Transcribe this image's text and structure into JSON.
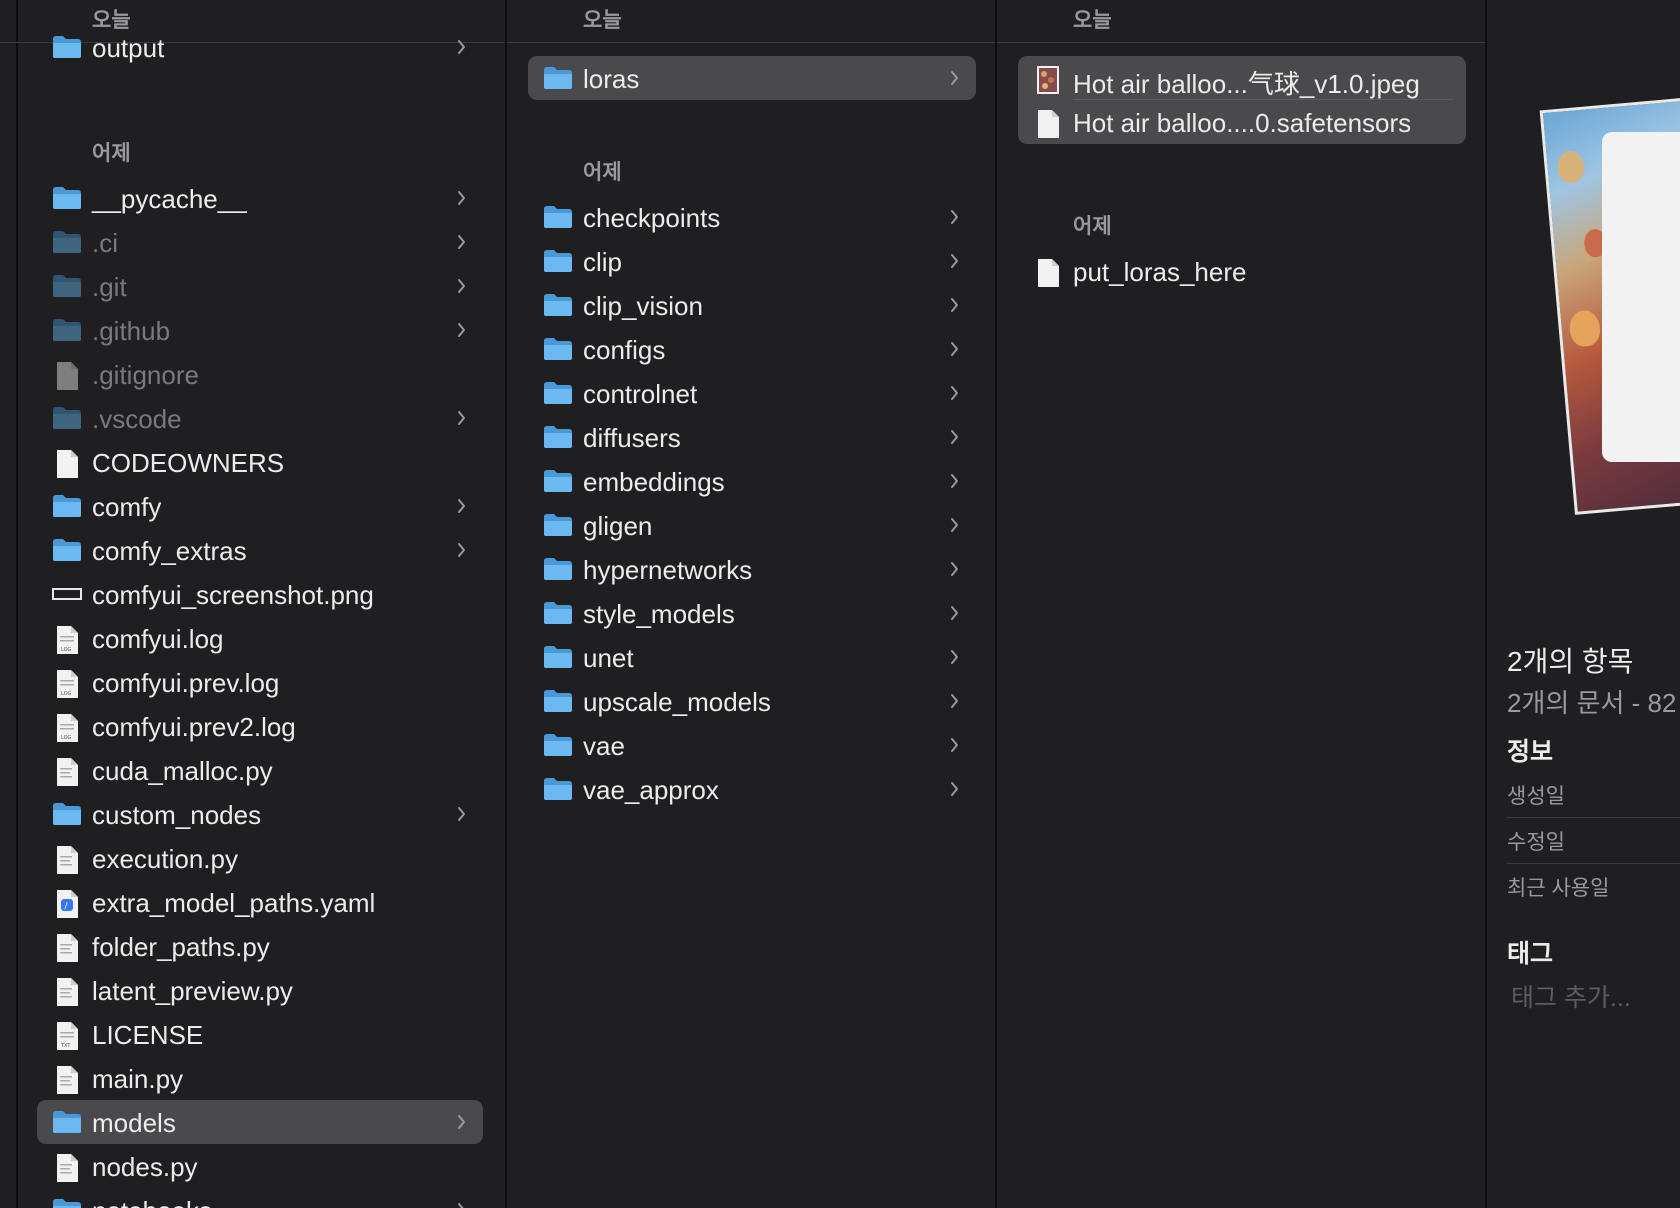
{
  "colors": {
    "background": "#1f1f21",
    "selection": "#4a4a4c",
    "folder": "#5aa9e6",
    "text": "#ececec",
    "secondary_text": "#9a9a9e"
  },
  "col1": {
    "header": "오늘",
    "top_item": {
      "label": "output",
      "icon": "folder-icon",
      "chevron": true
    },
    "section_yesterday": "어제",
    "items": [
      {
        "label": "__pycache__",
        "icon": "folder-icon",
        "chevron": true,
        "dim": false
      },
      {
        "label": ".ci",
        "icon": "folder-icon",
        "chevron": true,
        "dim": true
      },
      {
        "label": ".git",
        "icon": "folder-icon",
        "chevron": true,
        "dim": true
      },
      {
        "label": ".github",
        "icon": "folder-icon",
        "chevron": true,
        "dim": true
      },
      {
        "label": ".gitignore",
        "icon": "document-icon",
        "chevron": false,
        "dim": true
      },
      {
        "label": ".vscode",
        "icon": "folder-icon",
        "chevron": true,
        "dim": true
      },
      {
        "label": "CODEOWNERS",
        "icon": "document-icon",
        "chevron": false,
        "dim": false
      },
      {
        "label": "comfy",
        "icon": "folder-icon",
        "chevron": true,
        "dim": false
      },
      {
        "label": "comfy_extras",
        "icon": "folder-icon",
        "chevron": true,
        "dim": false
      },
      {
        "label": "comfyui_screenshot.png",
        "icon": "image-file-icon",
        "chevron": false,
        "dim": false
      },
      {
        "label": "comfyui.log",
        "icon": "log-file-icon",
        "chevron": false,
        "dim": false
      },
      {
        "label": "comfyui.prev.log",
        "icon": "log-file-icon",
        "chevron": false,
        "dim": false
      },
      {
        "label": "comfyui.prev2.log",
        "icon": "log-file-icon",
        "chevron": false,
        "dim": false
      },
      {
        "label": "cuda_malloc.py",
        "icon": "python-file-icon",
        "chevron": false,
        "dim": false
      },
      {
        "label": "custom_nodes",
        "icon": "folder-icon",
        "chevron": true,
        "dim": false
      },
      {
        "label": "execution.py",
        "icon": "python-file-icon",
        "chevron": false,
        "dim": false
      },
      {
        "label": "extra_model_paths.yaml",
        "icon": "yaml-file-icon",
        "chevron": false,
        "dim": false
      },
      {
        "label": "folder_paths.py",
        "icon": "python-file-icon",
        "chevron": false,
        "dim": false
      },
      {
        "label": "latent_preview.py",
        "icon": "python-file-icon",
        "chevron": false,
        "dim": false
      },
      {
        "label": "LICENSE",
        "icon": "text-file-icon",
        "chevron": false,
        "dim": false
      },
      {
        "label": "main.py",
        "icon": "python-file-icon",
        "chevron": false,
        "dim": false
      },
      {
        "label": "models",
        "icon": "folder-icon",
        "chevron": true,
        "dim": false,
        "selected": true
      },
      {
        "label": "nodes.py",
        "icon": "python-file-icon",
        "chevron": false,
        "dim": false
      },
      {
        "label": "notebooks",
        "icon": "folder-icon",
        "chevron": true,
        "dim": false
      }
    ]
  },
  "col2": {
    "header": "오늘",
    "top_item": {
      "label": "loras",
      "icon": "folder-icon",
      "chevron": true,
      "selected": true
    },
    "section_yesterday": "어제",
    "items": [
      {
        "label": "checkpoints"
      },
      {
        "label": "clip"
      },
      {
        "label": "clip_vision"
      },
      {
        "label": "configs"
      },
      {
        "label": "controlnet"
      },
      {
        "label": "diffusers"
      },
      {
        "label": "embeddings"
      },
      {
        "label": "gligen"
      },
      {
        "label": "hypernetworks"
      },
      {
        "label": "style_models"
      },
      {
        "label": "unet"
      },
      {
        "label": "upscale_models"
      },
      {
        "label": "vae"
      },
      {
        "label": "vae_approx"
      }
    ]
  },
  "col3": {
    "header": "오늘",
    "today_items": [
      {
        "label": "Hot air balloo...气球_v1.0.jpeg",
        "icon": "image-thumbnail-icon"
      },
      {
        "label": "Hot air balloo....0.safetensors",
        "icon": "document-icon"
      }
    ],
    "section_yesterday": "어제",
    "yesterday_items": [
      {
        "label": "put_loras_here",
        "icon": "document-icon"
      }
    ]
  },
  "preview": {
    "title": "2개의 항목",
    "subtitle": "2개의 문서 - 82",
    "info_heading": "정보",
    "info_rows": [
      "생성일",
      "수정일",
      "최근 사용일"
    ],
    "tags_heading": "태그",
    "tags_placeholder": "태그 추가..."
  }
}
